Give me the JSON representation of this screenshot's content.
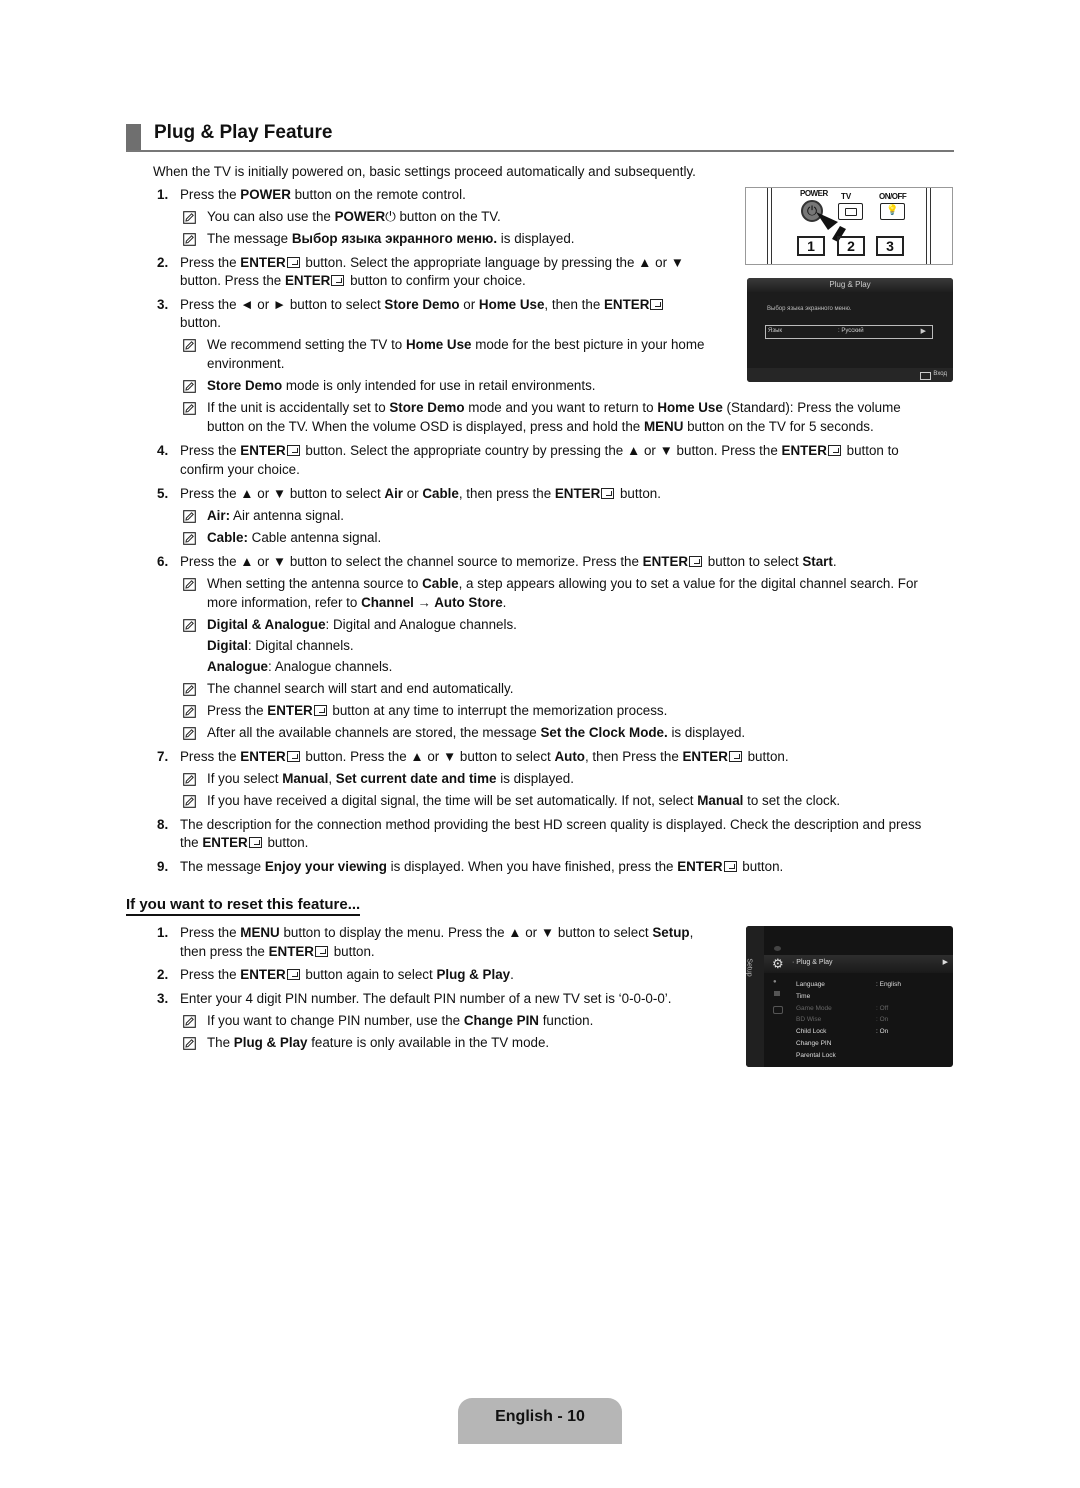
{
  "page": {
    "title": "Plug & Play Feature",
    "intro": "When the TV is initially powered on, basic settings proceed automatically and subsequently.",
    "enter_label": "ENTER",
    "steps": [
      {
        "n": "1.",
        "text": [
          "Press the ",
          {
            "b": "POWER"
          },
          " button on the remote control."
        ]
      },
      {
        "note": [
          "You can also use the ",
          {
            "b": "POWER"
          },
          " ⏻ button on the TV."
        ]
      },
      {
        "note": [
          "The message ",
          {
            "b": "Выбор языка экранного меню."
          },
          " is displayed."
        ]
      }
    ],
    "lines": {
      "s1": "Press the POWER button on the remote control.",
      "s1_n1a": "You can also use the ",
      "s1_n1b": "POWER",
      "s1_n1c": " button on the TV.",
      "s1_n2a": "The message ",
      "s1_n2b": "Выбор языка экранного меню.",
      "s1_n2c": " is displayed.",
      "s2a": "Press the ",
      "s2b": " button. Select the appropriate language by pressing the ▲ or ▼",
      "s2c": "button. Press the ",
      "s2d": " button to confirm your choice.",
      "s3a": "Press the ◄ or ► button to select ",
      "s3b": "Store Demo",
      "s3c": " or ",
      "s3d": "Home Use",
      "s3e": ", then the ",
      "s3f": "button.",
      "s3_n1a": "We recommend setting the TV to ",
      "s3_n1b": "Home Use",
      "s3_n1c": " mode for the best picture in your home",
      "s3_n1d": "environment.",
      "s3_n2a": "Store Demo",
      "s3_n2b": " mode is only intended for use in retail environments.",
      "s3_n3a": "If the unit is accidentally set to ",
      "s3_n3b": "Store Demo",
      "s3_n3c": " mode and you want to return to ",
      "s3_n3d": "Home Use",
      "s3_n3e": " (Standard): Press the volume",
      "s3_n3f": "button on the TV. When the volume OSD is displayed, press and hold the ",
      "s3_n3g": "MENU",
      "s3_n3h": " button on the TV for 5 seconds.",
      "s4a": "Press the ",
      "s4b": " button. Select the appropriate country by pressing the ▲ or ▼ button. Press the ",
      "s4c": " button to",
      "s4d": "confirm your choice.",
      "s5a": "Press the ▲ or ▼ button to select ",
      "s5b": "Air",
      "s5c": " or ",
      "s5d": "Cable",
      "s5e": ", then press the ",
      "s5f": " button.",
      "s5_n1a": "Air:",
      "s5_n1b": " Air antenna signal.",
      "s5_n2a": "Cable:",
      "s5_n2b": " Cable antenna signal.",
      "s6a": "Press the ▲ or ▼ button to select the channel source to memorize. Press the ",
      "s6b": " button to select ",
      "s6c": "Start",
      "s6d": ".",
      "s6_n1a": "When setting the antenna source to ",
      "s6_n1b": "Cable",
      "s6_n1c": ", a step appears allowing you to set a value for the digital channel search. For",
      "s6_n1d": "more information, refer to ",
      "s6_n1e": "Channel → Auto Store",
      "s6_n1f": ".",
      "s6_n2a": "Digital & Analogue",
      "s6_n2b": ": Digital and Analogue channels.",
      "s6_n2c": "Digital",
      "s6_n2d": ": Digital channels.",
      "s6_n2e": "Analogue",
      "s6_n2f": ": Analogue channels.",
      "s6_n3": "The channel search will start and end automatically.",
      "s6_n4a": "Press the ",
      "s6_n4b": " button at any time to interrupt the memorization process.",
      "s6_n5a": "After all the available channels are stored, the message ",
      "s6_n5b": "Set the Clock Mode.",
      "s6_n5c": " is displayed.",
      "s7a": "Press the ",
      "s7b": " button. Press the ▲ or ▼ button to select ",
      "s7c": "Auto",
      "s7d": ", then Press the ",
      "s7e": " button.",
      "s7_n1a": "If you select ",
      "s7_n1b": "Manual",
      "s7_n1c": ", ",
      "s7_n1d": "Set current date and time",
      "s7_n1e": " is displayed.",
      "s7_n2a": "If you have received a digital signal, the time will be set automatically. If not, select ",
      "s7_n2b": "Manual",
      "s7_n2c": " to set the clock.",
      "s8a": "The description for the connection method providing the best HD screen quality is displayed. Check the description and press",
      "s8b": "the ",
      "s8c": " button.",
      "s9a": "The message ",
      "s9b": "Enjoy your viewing",
      "s9c": " is displayed. When you have finished, press the ",
      "s9d": " button."
    },
    "numbers": [
      "1.",
      "2.",
      "3.",
      "4.",
      "5.",
      "6.",
      "7.",
      "8.",
      "9."
    ],
    "reset": {
      "title": "If you want to reset this feature...",
      "r1a": "Press the ",
      "r1b": "MENU",
      "r1c": " button to display the menu. Press the ▲ or ▼ button to select ",
      "r1d": "Setup",
      "r1e": ",",
      "r1f": "then press the ",
      "r1g": " button.",
      "r2a": "Press the ",
      "r2b": " button again to select ",
      "r2c": "Plug & Play",
      "r2d": ".",
      "r3": "Enter your 4 digit PIN number. The default PIN number of a new TV set is ‘0-0-0-0’.",
      "r3_n1a": "If you want to change PIN number, use the ",
      "r3_n1b": "Change PIN",
      "r3_n1c": " function.",
      "r3_n2a": "The ",
      "r3_n2b": "Plug & Play",
      "r3_n2c": " feature is only available in the TV mode."
    },
    "remote": {
      "power_label": "POWER",
      "tv_label": "TV",
      "onoff_label": "ON/OFF",
      "keys": [
        "1",
        "2",
        "3"
      ]
    },
    "osd_plug": {
      "title": "Plug & Play",
      "message": "Выбор языка экранного меню.",
      "field_label": "Язык",
      "field_value": ": Русский",
      "enter_hint": "Вход"
    },
    "osd_setup": {
      "side_label": "Setup",
      "selected": "Plug & Play",
      "items": [
        {
          "label": "Language",
          "value": ": English",
          "dim": false
        },
        {
          "label": "Time",
          "value": "",
          "dim": false
        },
        {
          "label": "Game Mode",
          "value": ": Off",
          "dim": true
        },
        {
          "label": "BD Wise",
          "value": ": On",
          "dim": true
        },
        {
          "label": "Child Lock",
          "value": ": On",
          "dim": false
        },
        {
          "label": "Change PIN",
          "value": "",
          "dim": false
        },
        {
          "label": "Parental Lock",
          "value": "",
          "dim": false
        }
      ]
    },
    "footer": "English - 10"
  }
}
